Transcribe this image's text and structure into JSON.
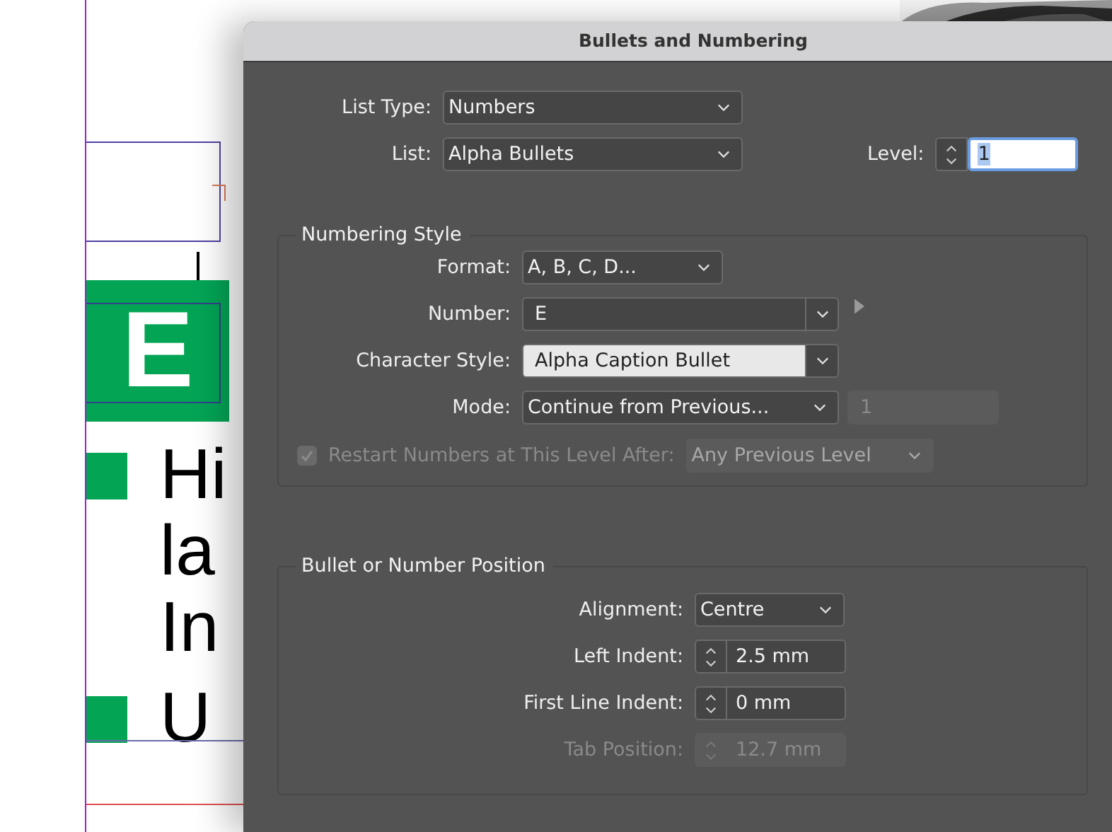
{
  "document": {
    "badge_letter": "E",
    "bullets": [
      {
        "lines": [
          "Hi",
          "la",
          "In"
        ]
      },
      {
        "lines": [
          "U"
        ]
      }
    ]
  },
  "dialog": {
    "title": "Bullets and Numbering",
    "list_type": {
      "label": "List Type:",
      "value": "Numbers"
    },
    "list": {
      "label": "List:",
      "value": "Alpha Bullets"
    },
    "level": {
      "label": "Level:",
      "value": "1",
      "highlighted": true
    },
    "numbering_style": {
      "title": "Numbering Style",
      "format": {
        "label": "Format:",
        "value": "A, B, C, D..."
      },
      "number": {
        "label": "Number:",
        "value": "E"
      },
      "character_style": {
        "label": "Character Style:",
        "value": "Alpha Caption Bullet"
      },
      "mode": {
        "label": "Mode:",
        "value": "Continue from Previous...",
        "start_at": {
          "value": "1",
          "disabled": true
        }
      },
      "restart": {
        "label": "Restart Numbers at This Level After:",
        "checked": true,
        "disabled": true,
        "value": "Any Previous Level"
      }
    },
    "position": {
      "title": "Bullet or Number Position",
      "rows": [
        {
          "kind": "dropdown",
          "label": "Alignment:",
          "value": "Centre",
          "disabled": false
        },
        {
          "kind": "spinner",
          "label": "Left Indent:",
          "value": "2.5 mm",
          "disabled": false
        },
        {
          "kind": "spinner",
          "label": "First Line Indent:",
          "value": "0 mm",
          "disabled": false
        },
        {
          "kind": "spinner",
          "label": "Tab Position:",
          "value": "12.7 mm",
          "disabled": true
        }
      ]
    }
  }
}
